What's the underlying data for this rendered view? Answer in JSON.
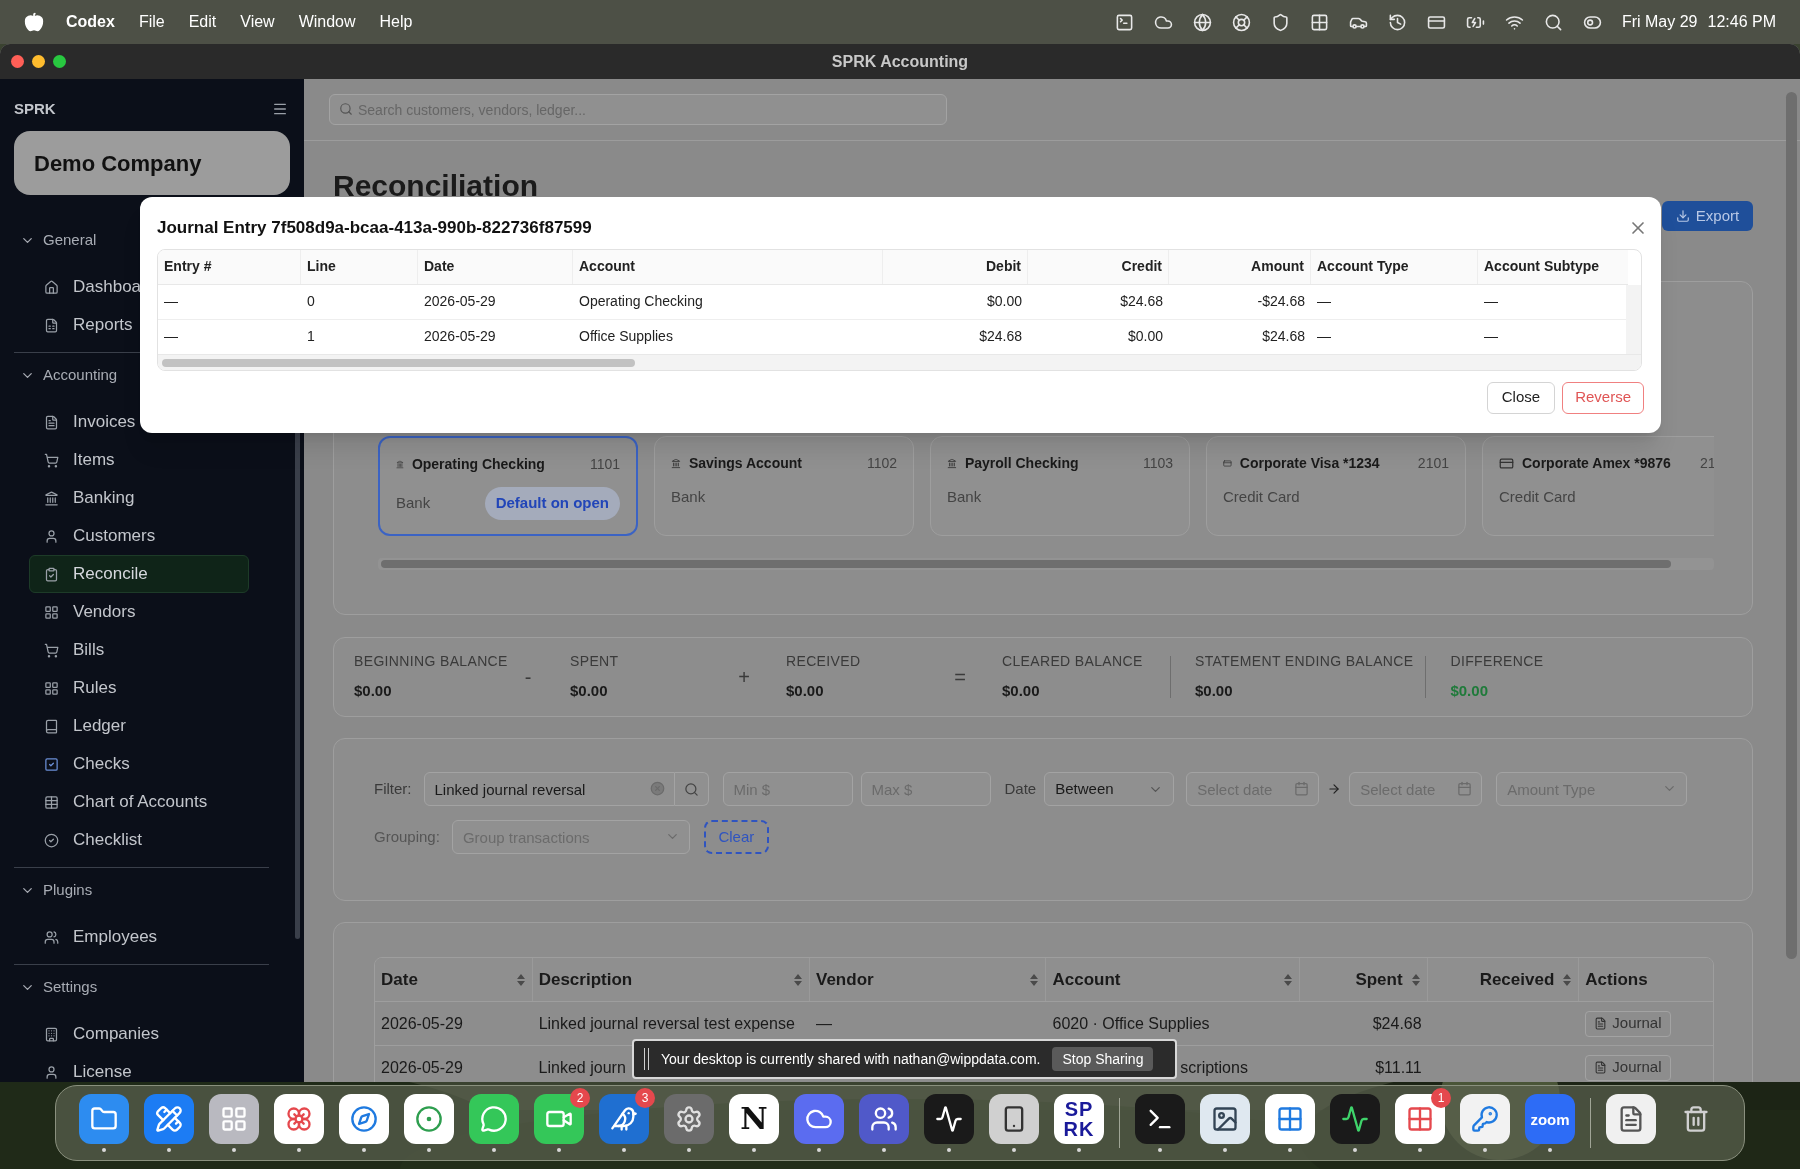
{
  "menu_bar": {
    "app_name": "Codex",
    "menus": [
      "File",
      "Edit",
      "View",
      "Window",
      "Help"
    ],
    "date": "Fri May 29",
    "time": "12:46 PM"
  },
  "window": {
    "title": "SPRK Accounting"
  },
  "sidebar": {
    "brand": "SPRK",
    "company": "Demo Company",
    "sections": [
      {
        "title": "General",
        "expanded": true,
        "items": [
          {
            "label": "Dashboa",
            "selected": false
          },
          {
            "label": "Reports",
            "selected": false
          }
        ]
      },
      {
        "title": "Accounting",
        "expanded": true,
        "items": [
          {
            "label": "Invoices",
            "selected": false
          },
          {
            "label": "Items",
            "selected": false
          },
          {
            "label": "Banking",
            "selected": false
          },
          {
            "label": "Customers",
            "selected": false
          },
          {
            "label": "Reconcile",
            "selected": true
          },
          {
            "label": "Vendors",
            "selected": false
          },
          {
            "label": "Bills",
            "selected": false
          },
          {
            "label": "Rules",
            "selected": false
          },
          {
            "label": "Ledger",
            "selected": false
          },
          {
            "label": "Checks",
            "selected": false
          },
          {
            "label": "Chart of Accounts",
            "selected": false
          },
          {
            "label": "Checklist",
            "selected": false
          }
        ]
      },
      {
        "title": "Plugins",
        "expanded": true,
        "items": [
          {
            "label": "Employees",
            "selected": false
          }
        ]
      },
      {
        "title": "Settings",
        "expanded": true,
        "items": [
          {
            "label": "Companies",
            "selected": false
          },
          {
            "label": "License",
            "selected": false
          }
        ]
      }
    ]
  },
  "search": {
    "placeholder": "Search customers, vendors, ledger..."
  },
  "page": {
    "title": "Reconciliation",
    "export_button": "Export"
  },
  "accounts": [
    {
      "kind": "bank",
      "name": "Operating Checking",
      "number": "1101",
      "type": "Bank",
      "selected": true,
      "badge": "Default on open"
    },
    {
      "kind": "bank",
      "name": "Savings Account",
      "number": "1102",
      "type": "Bank",
      "selected": false
    },
    {
      "kind": "bank",
      "name": "Payroll Checking",
      "number": "1103",
      "type": "Bank",
      "selected": false
    },
    {
      "kind": "card",
      "name": "Corporate Visa *1234",
      "number": "2101",
      "type": "Credit Card",
      "selected": false
    },
    {
      "kind": "card",
      "name": "Corporate Amex *9876",
      "number": "21",
      "type": "Credit Card",
      "selected": false
    }
  ],
  "summary": [
    {
      "kind": "figure",
      "label": "BEGINNING BALANCE",
      "value": "$0.00",
      "highlight": false
    },
    {
      "kind": "operator",
      "symbol": "-"
    },
    {
      "kind": "figure",
      "label": "SPENT",
      "value": "$0.00",
      "highlight": false
    },
    {
      "kind": "operator",
      "symbol": "+"
    },
    {
      "kind": "figure",
      "label": "RECEIVED",
      "value": "$0.00",
      "highlight": false
    },
    {
      "kind": "operator",
      "symbol": "="
    },
    {
      "kind": "figure",
      "label": "CLEARED BALANCE",
      "value": "$0.00",
      "highlight": false
    },
    {
      "kind": "divider"
    },
    {
      "kind": "figure",
      "label": "STATEMENT ENDING BALANCE",
      "value": "$0.00",
      "highlight": false
    },
    {
      "kind": "divider"
    },
    {
      "kind": "figure",
      "label": "DIFFERENCE",
      "value": "$0.00",
      "highlight": true
    }
  ],
  "filter": {
    "label": "Filter:",
    "query": "Linked journal reversal",
    "min_placeholder": "Min $",
    "max_placeholder": "Max $",
    "date_label": "Date",
    "date_mode": "Between",
    "from_placeholder": "Select date",
    "to_placeholder": "Select date",
    "amount_type_placeholder": "Amount Type",
    "grouping_label": "Grouping:",
    "grouping_placeholder": "Group transactions",
    "clear_button": "Clear"
  },
  "transactions": {
    "columns": [
      {
        "label": "Date",
        "sortable": true
      },
      {
        "label": "Description",
        "sortable": true
      },
      {
        "label": "Vendor",
        "sortable": true
      },
      {
        "label": "Account",
        "sortable": true
      },
      {
        "label": "Spent",
        "sortable": true
      },
      {
        "label": "Received",
        "sortable": true
      },
      {
        "label": "Actions",
        "sortable": false
      }
    ],
    "rows": [
      {
        "date": "2026-05-29",
        "description": "Linked journal reversal test expense",
        "vendor": "—",
        "account": "6020 · Office Supplies",
        "spent": "$24.68",
        "action": "Journal"
      },
      {
        "date": "2026-05-29",
        "description": "Linked journ",
        "account": "scriptions",
        "spent": "$11.11",
        "action": "Journal"
      }
    ]
  },
  "modal": {
    "title": "Journal Entry 7f508d9a-bcaa-413a-990b-822736f87599",
    "columns": [
      "Entry #",
      "Line",
      "Date",
      "Account",
      "Debit",
      "Credit",
      "Amount",
      "Account Type",
      "Account Subtype"
    ],
    "rows": [
      [
        "—",
        "0",
        "2026-05-29",
        "Operating Checking",
        "$0.00",
        "$24.68",
        "-$24.68",
        "—",
        "—"
      ],
      [
        "—",
        "1",
        "2026-05-29",
        "Office Supplies",
        "$24.68",
        "$0.00",
        "$24.68",
        "—",
        "—"
      ]
    ],
    "close_button": "Close",
    "reverse_button": "Reverse"
  },
  "share_banner": {
    "message": "Your desktop is currently shared with nathan@wippdata.com.",
    "button": "Stop Sharing"
  },
  "dock": [
    {
      "kind": "app",
      "running": true
    },
    {
      "kind": "app",
      "running": true
    },
    {
      "kind": "app",
      "running": true
    },
    {
      "kind": "app",
      "running": true
    },
    {
      "kind": "app",
      "running": true
    },
    {
      "kind": "app",
      "running": true
    },
    {
      "kind": "app",
      "running": true
    },
    {
      "kind": "app",
      "running": true,
      "badge": "2"
    },
    {
      "kind": "app",
      "running": true,
      "badge": "3"
    },
    {
      "kind": "app",
      "running": true
    },
    {
      "kind": "app",
      "running": true,
      "glyph": "N"
    },
    {
      "kind": "app",
      "running": true
    },
    {
      "kind": "app",
      "running": true
    },
    {
      "kind": "app",
      "running": true
    },
    {
      "kind": "app",
      "running": true
    },
    {
      "kind": "app",
      "running": true,
      "glyph_lines": [
        "SP",
        "RK"
      ]
    },
    {
      "kind": "separator"
    },
    {
      "kind": "app",
      "running": true
    },
    {
      "kind": "app",
      "running": true
    },
    {
      "kind": "app",
      "running": true
    },
    {
      "kind": "app",
      "running": true
    },
    {
      "kind": "app",
      "running": true,
      "badge": "1"
    },
    {
      "kind": "app",
      "running": true
    },
    {
      "kind": "app",
      "running": true,
      "glyph": "zoom"
    },
    {
      "kind": "separator"
    },
    {
      "kind": "app",
      "running": false
    },
    {
      "kind": "app",
      "running": false
    }
  ]
}
